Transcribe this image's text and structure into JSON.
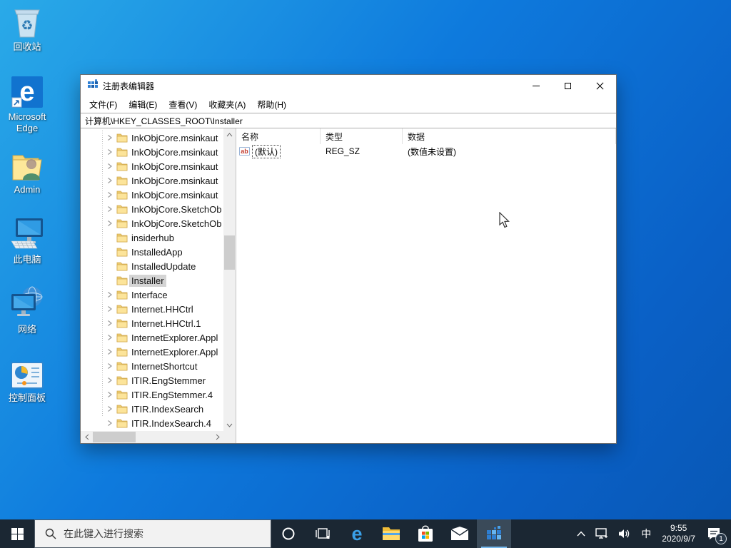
{
  "colors": {
    "desktop_top": "#2aaae8",
    "desktop_bottom": "#0857b4",
    "taskbar": "#1b2733",
    "taskbar_active_tile": "#3a4a59",
    "taskbar_active_underline": "#76b9ed",
    "tree_selection": "#d4d4d4",
    "folder_yellow": "#fce49a",
    "window_border": "#6e6e6e",
    "reg_sz_icon_red": "#c33b2e"
  },
  "icons": {
    "titlebar": "registry-cubes-icon",
    "tray": [
      "chevron-up-icon",
      "network-icon",
      "volume-icon",
      "notification-icon"
    ],
    "taskbar": [
      "start-icon",
      "search-icon",
      "cortana-icon",
      "task-view-icon",
      "edge-icon",
      "file-explorer-icon",
      "store-icon",
      "mail-icon",
      "regedit-icon"
    ]
  },
  "desktop": {
    "icons": [
      {
        "label": "回收站"
      },
      {
        "label": "Microsoft Edge"
      },
      {
        "label": "Admin"
      },
      {
        "label": "此电脑"
      },
      {
        "label": "网络"
      },
      {
        "label": "控制面板"
      }
    ]
  },
  "window": {
    "title": "注册表编辑器",
    "menus": [
      "文件(F)",
      "编辑(E)",
      "查看(V)",
      "收藏夹(A)",
      "帮助(H)"
    ],
    "address": "计算机\\HKEY_CLASSES_ROOT\\Installer"
  },
  "tree": {
    "items": [
      {
        "label": "InkObjCore.msinkaut",
        "expandable": true,
        "selected": false
      },
      {
        "label": "InkObjCore.msinkaut",
        "expandable": true,
        "selected": false
      },
      {
        "label": "InkObjCore.msinkaut",
        "expandable": true,
        "selected": false
      },
      {
        "label": "InkObjCore.msinkaut",
        "expandable": true,
        "selected": false
      },
      {
        "label": "InkObjCore.msinkaut",
        "expandable": true,
        "selected": false
      },
      {
        "label": "InkObjCore.SketchOb",
        "expandable": true,
        "selected": false
      },
      {
        "label": "InkObjCore.SketchOb",
        "expandable": true,
        "selected": false
      },
      {
        "label": "insiderhub",
        "expandable": false,
        "selected": false
      },
      {
        "label": "InstalledApp",
        "expandable": false,
        "selected": false
      },
      {
        "label": "InstalledUpdate",
        "expandable": false,
        "selected": false
      },
      {
        "label": "Installer",
        "expandable": false,
        "selected": true
      },
      {
        "label": "Interface",
        "expandable": true,
        "selected": false
      },
      {
        "label": "Internet.HHCtrl",
        "expandable": true,
        "selected": false
      },
      {
        "label": "Internet.HHCtrl.1",
        "expandable": true,
        "selected": false
      },
      {
        "label": "InternetExplorer.Appl",
        "expandable": true,
        "selected": false
      },
      {
        "label": "InternetExplorer.Appl",
        "expandable": true,
        "selected": false
      },
      {
        "label": "InternetShortcut",
        "expandable": true,
        "selected": false
      },
      {
        "label": "ITIR.EngStemmer",
        "expandable": true,
        "selected": false
      },
      {
        "label": "ITIR.EngStemmer.4",
        "expandable": true,
        "selected": false
      },
      {
        "label": "ITIR.IndexSearch",
        "expandable": true,
        "selected": false
      },
      {
        "label": "ITIR.IndexSearch.4",
        "expandable": true,
        "selected": false
      }
    ]
  },
  "list": {
    "columns": [
      "名称",
      "类型",
      "数据"
    ],
    "rows": [
      {
        "name": "(默认)",
        "type": "REG_SZ",
        "data": "(数值未设置)"
      }
    ]
  },
  "taskbar": {
    "search_placeholder": "在此键入进行搜索",
    "ime": "中",
    "time": "9:55",
    "date": "2020/9/7",
    "notification_count": "1"
  }
}
